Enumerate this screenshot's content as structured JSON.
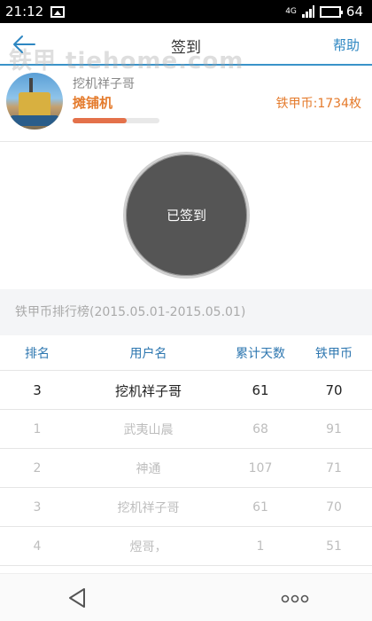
{
  "status_bar": {
    "time": "21:12",
    "network": "4G",
    "battery": "64",
    "battery_color": "#5cc63f"
  },
  "header": {
    "title": "签到",
    "help_label": "帮助",
    "back_icon": "arrow-left-icon",
    "accent_color": "#3a93c9"
  },
  "watermark": "铁甲 tiehome.com",
  "profile": {
    "username": "挖机祥子哥",
    "machine": "摊铺机",
    "coins_text": "铁甲币:1734枚",
    "level_progress": 0.62
  },
  "sign_in": {
    "label": "已签到"
  },
  "ranking": {
    "title": "铁甲币排行榜(2015.05.01-2015.05.01)",
    "columns": [
      "排名",
      "用户名",
      "累计天数",
      "铁甲币"
    ],
    "me": {
      "rank": "3",
      "name": "挖机祥子哥",
      "days": "61",
      "coins": "70"
    },
    "rows": [
      {
        "rank": "1",
        "name": "武夷山晨",
        "days": "68",
        "coins": "91"
      },
      {
        "rank": "2",
        "name": "神通",
        "days": "107",
        "coins": "71"
      },
      {
        "rank": "3",
        "name": "挖机祥子哥",
        "days": "61",
        "coins": "70"
      },
      {
        "rank": "4",
        "name": "煜哥，",
        "days": "1",
        "coins": "51"
      }
    ]
  },
  "nav": {
    "back_icon": "nav-back-triangle-icon",
    "menu_icon": "more-dots-icon"
  }
}
